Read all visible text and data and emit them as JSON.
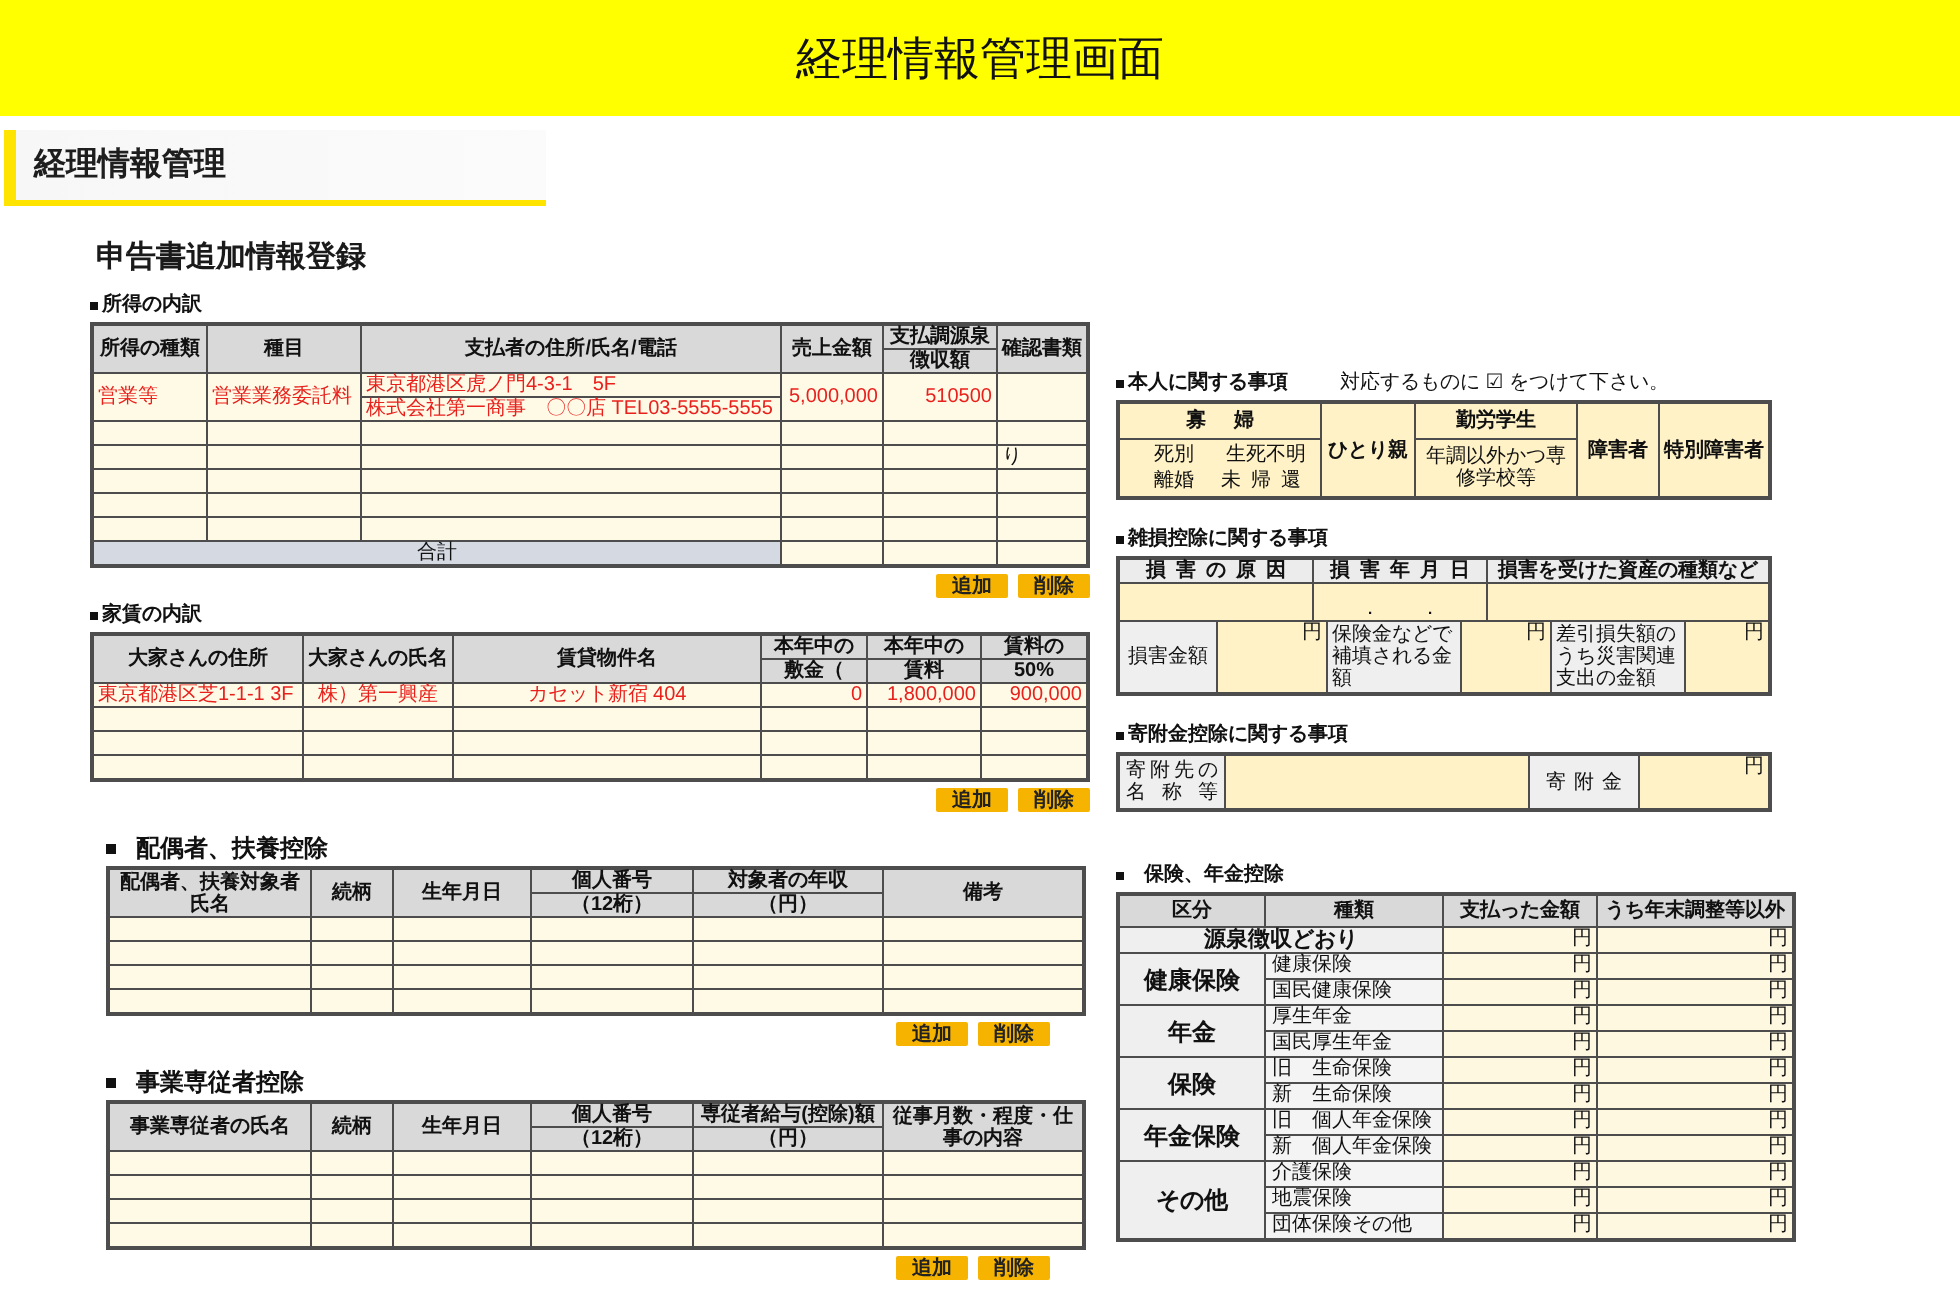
{
  "header": {
    "title": "経理情報管理画面"
  },
  "section_tab": {
    "title": "経理情報管理"
  },
  "page_heading": "申告書追加情報登録",
  "left_sections": [
    {
      "kind": "breakdown",
      "title": "所得の内訳",
      "columns": [
        {
          "kind": "text",
          "label": "所得の種類"
        },
        {
          "kind": "text",
          "label": "種目"
        },
        {
          "kind": "text",
          "label": "支払者の住所/氏名/電話"
        },
        {
          "kind": "amount",
          "label": "売上金額"
        },
        {
          "kind": "amount",
          "label": "支払調源泉",
          "sublabel": "徴収額"
        },
        {
          "kind": "note",
          "label": "確認書類"
        }
      ],
      "rows": [
        {
          "cells": [
            {
              "text": "営業等"
            },
            {
              "text": "営業業務委託料"
            },
            {
              "lines": [
                "東京都港区虎ノ門4-3-1　5F",
                "株式会社第一商事　〇〇店 TEL03-5555-5555"
              ]
            },
            {
              "text": "5,000,000"
            },
            {
              "text": "510500"
            },
            {}
          ]
        },
        {},
        {
          "cells": [
            {},
            {},
            {},
            {},
            {},
            {
              "text": "り"
            }
          ]
        },
        {},
        {},
        {}
      ],
      "total": {
        "label": "合計"
      },
      "buttons": [
        "追加",
        "削除"
      ]
    },
    {
      "kind": "breakdown",
      "title": "家賃の内訳",
      "columns": [
        {
          "kind": "text",
          "label": "大家さんの住所"
        },
        {
          "kind": "name",
          "label": "大家さんの氏名"
        },
        {
          "kind": "name",
          "label": "賃貸物件名"
        },
        {
          "kind": "amount",
          "label": "本年中の",
          "sublabel": "敷金（"
        },
        {
          "kind": "amount",
          "label": "本年中の",
          "sublabel": "賃料"
        },
        {
          "kind": "amount",
          "label": "賃料の",
          "sublabel": "50%"
        }
      ],
      "rows": [
        {
          "cells": [
            {
              "text": "東京都港区芝1-1-1 3F"
            },
            {
              "text": "株）第一興産"
            },
            {
              "text": "カセット新宿 404"
            },
            {
              "text": "0"
            },
            {
              "text": "1,800,000"
            },
            {
              "text": "900,000"
            }
          ]
        },
        {},
        {},
        {}
      ],
      "buttons": [
        "追加",
        "削除"
      ]
    },
    {
      "kind": "deduction",
      "title": "配偶者、扶養控除",
      "columns": [
        {
          "kind": "text",
          "label": "配偶者、扶養対象者氏名"
        },
        {
          "kind": "text",
          "label": "続柄"
        },
        {
          "kind": "text",
          "label": "生年月日"
        },
        {
          "kind": "text",
          "label": "個人番号",
          "sublabel": "（12桁）"
        },
        {
          "kind": "amount",
          "label": "対象者の年収",
          "sublabel": "（円）"
        },
        {
          "kind": "text",
          "label": "備考"
        }
      ],
      "rows": [
        {},
        {},
        {},
        {}
      ],
      "buttons": [
        "追加",
        "削除"
      ]
    },
    {
      "kind": "deduction",
      "title": "事業専従者控除",
      "columns": [
        {
          "kind": "text",
          "label": "事業専従者の氏名"
        },
        {
          "kind": "text",
          "label": "続柄"
        },
        {
          "kind": "text",
          "label": "生年月日"
        },
        {
          "kind": "text",
          "label": "個人番号",
          "sublabel": "（12桁）"
        },
        {
          "kind": "amount",
          "label": "専従者給与(控除)額",
          "sublabel": "（円）"
        },
        {
          "kind": "text",
          "label": "従事月数・程度・仕事の内容"
        }
      ],
      "rows": [
        {},
        {},
        {},
        {}
      ],
      "buttons": [
        "追加",
        "削除"
      ]
    }
  ],
  "right_sections": [
    {
      "kind": "personal",
      "title": "本人に関する事項",
      "note": "対応するものに ☑ をつけて下さい。",
      "widow": {
        "label": "寡婦",
        "options": [
          "死別",
          "生死不明",
          "離婚",
          "未帰還"
        ]
      },
      "single_parent": {
        "label": "ひとり親"
      },
      "working_student": {
        "label": "勤労学生",
        "condition": "年調以外かつ専修学校等"
      },
      "disability": {
        "label": "障害者"
      },
      "special_disability": {
        "label": "特別障害者"
      }
    },
    {
      "kind": "casualty",
      "title": "雑損控除に関する事項",
      "columns": [
        "損害の原因",
        "損害年月日",
        "損害を受けた資産の種類など"
      ],
      "entry": [
        {
          "kind": "field"
        },
        {
          "kind": "date",
          "value": "．　　．"
        },
        {
          "kind": "field"
        }
      ],
      "amounts": [
        {
          "kind": "label",
          "text": "損害金額"
        },
        {
          "kind": "amount",
          "unit": "円"
        },
        {
          "kind": "label",
          "text": "保険金などで補填される金額"
        },
        {
          "kind": "amount",
          "unit": "円"
        },
        {
          "kind": "label",
          "text": "差引損失額のうち災害関連支出の金額"
        },
        {
          "kind": "amount",
          "unit": "円"
        }
      ]
    },
    {
      "kind": "donation",
      "title": "寄附金控除に関する事項",
      "cells": [
        {
          "kind": "label",
          "text": "寄附先の名称等"
        },
        {
          "kind": "field"
        },
        {
          "kind": "label",
          "text": "寄附金"
        },
        {
          "kind": "amount",
          "unit": "円"
        }
      ]
    },
    {
      "kind": "insurance",
      "title": "保険、年金控除",
      "columns": [
        "区分",
        "種類",
        "支払った金額",
        "うち年末調整等以外"
      ],
      "withholding": {
        "label": "源泉徴収どおり",
        "units": [
          "円",
          "円"
        ]
      },
      "groups": [
        {
          "category": "健康保険",
          "items": [
            {
              "type": "健康保険",
              "units": [
                "円",
                "円"
              ]
            },
            {
              "type": "国民健康保険",
              "units": [
                "円",
                "円"
              ]
            }
          ]
        },
        {
          "category": "年金",
          "items": [
            {
              "type": "厚生年金",
              "units": [
                "円",
                "円"
              ]
            },
            {
              "type": "国民厚生年金",
              "units": [
                "円",
                "円"
              ]
            }
          ]
        },
        {
          "category": "保険",
          "items": [
            {
              "type": "旧　生命保険",
              "units": [
                "円",
                "円"
              ]
            },
            {
              "type": "新　生命保険",
              "units": [
                "円",
                "円"
              ]
            }
          ]
        },
        {
          "category": "年金保険",
          "items": [
            {
              "type": "旧　個人年金保険",
              "units": [
                "円",
                "円"
              ]
            },
            {
              "type": "新　個人年金保険",
              "units": [
                "円",
                "円"
              ]
            }
          ]
        },
        {
          "category": "その他",
          "items": [
            {
              "type": "介護保険",
              "units": [
                "円",
                "円"
              ]
            },
            {
              "type": "地震保険",
              "units": [
                "円",
                "円"
              ]
            },
            {
              "type": "団体保険その他",
              "units": [
                "円",
                "円"
              ]
            }
          ]
        }
      ]
    }
  ]
}
